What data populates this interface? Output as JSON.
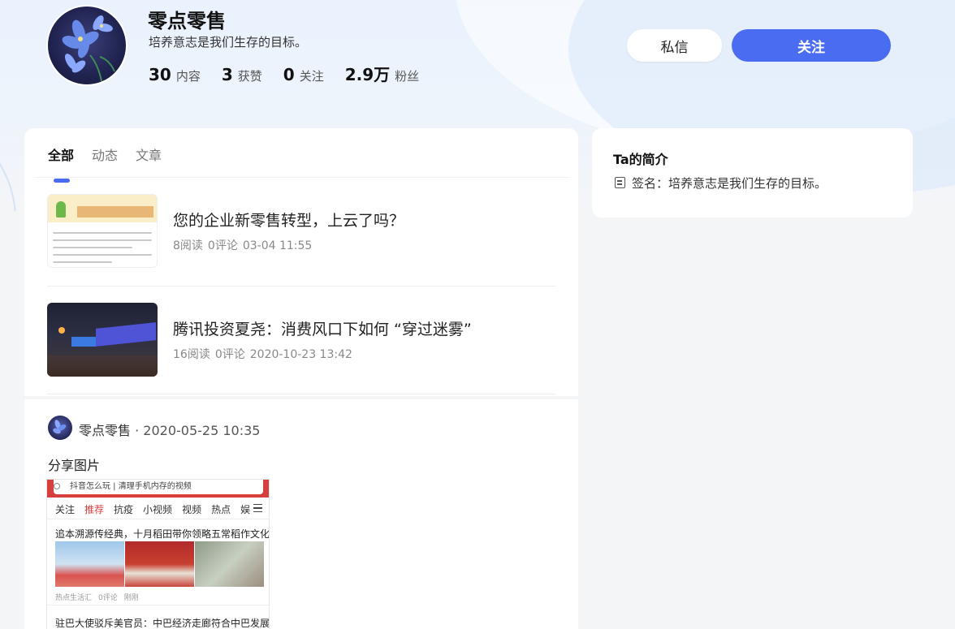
{
  "profile": {
    "name": "零点零售",
    "bio": "培养意志是我们生存的目标。",
    "stats": [
      {
        "num": "30",
        "label": "内容"
      },
      {
        "num": "3",
        "label": "获赞"
      },
      {
        "num": "0",
        "label": "关注"
      },
      {
        "num": "2.9万",
        "label": "粉丝"
      }
    ],
    "message_button": "私信",
    "follow_button": "关注"
  },
  "tabs": [
    {
      "label": "全部",
      "active": true
    },
    {
      "label": "动态",
      "active": false
    },
    {
      "label": "文章",
      "active": false
    }
  ],
  "articles": [
    {
      "title": "您的企业新零售转型，上云了吗？",
      "reads": "8阅读",
      "comments": "0评论",
      "time": "03-04 11:55"
    },
    {
      "title": "腾讯投资夏尧：消费风口下如何 “穿过迷雾”",
      "reads": "16阅读",
      "comments": "0评论",
      "time": "2020-10-23 13:42"
    }
  ],
  "feed": {
    "author": "零点零售",
    "time": "· 2020-05-25 10:35",
    "text": "分享图片",
    "shared_image": {
      "search_text": "抖音怎么玩 | 清理手机内存的视频",
      "nav": [
        "关注",
        "推荐",
        "抗疫",
        "小视频",
        "视频",
        "热点",
        "娱"
      ],
      "headline1": "追本溯源传经典，十月稻田带你领略五常稻作文化",
      "meta": [
        "热点生活汇",
        "0评论",
        "刚刚"
      ],
      "headline2": "驻巴大使驳斥美官员：中巴经济走廊符合中巴发展"
    }
  },
  "sidebar": {
    "title": "Ta的简介",
    "signature": "签名：培养意志是我们生存的目标。"
  },
  "colors": {
    "accent": "#4a6cf0"
  }
}
